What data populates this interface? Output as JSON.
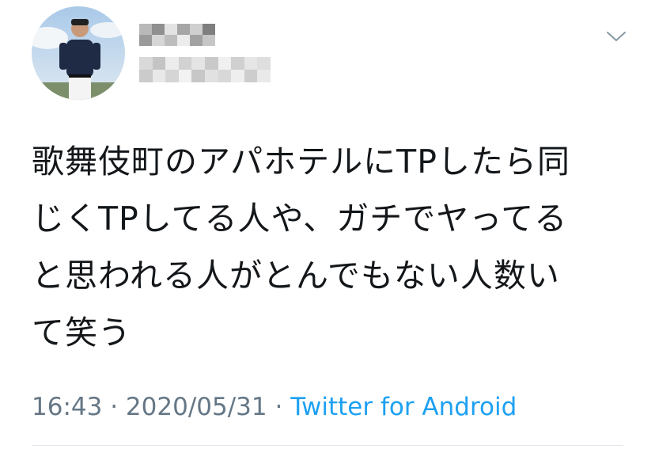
{
  "tweet": {
    "avatar_icon": "user-avatar-photo",
    "name_pixelated": true,
    "handle_pixelated": true,
    "menu_icon": "chevron-down-icon",
    "text": "歌舞伎町のアパホテルにTPしたら同\nじくTPしてる人や、ガチでヤってる\nと思われる人がとんでもない人数い\nて笑う",
    "time": "16:43",
    "separator": "·",
    "date": "2020/05/31",
    "source": "Twitter for Android"
  },
  "colors": {
    "text": "#14171a",
    "muted": "#657786",
    "link": "#1da1f2",
    "divider": "#e1e8ed"
  }
}
